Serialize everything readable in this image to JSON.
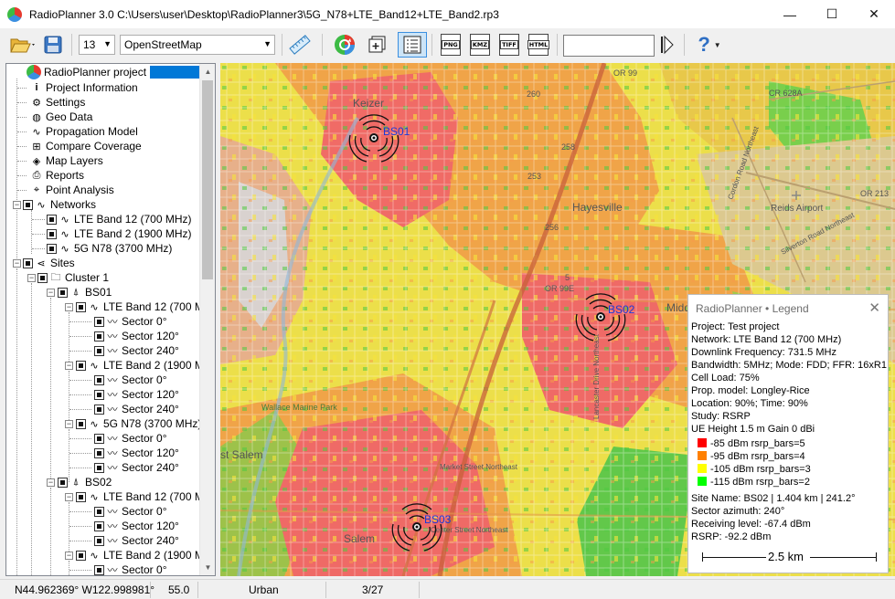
{
  "window": {
    "title": "RadioPlanner 3.0 C:\\Users\\user\\Desktop\\RadioPlanner3\\5G_N78+LTE_Band12+LTE_Band2.rp3",
    "minimize": "—",
    "maximize": "☐",
    "close": "✕"
  },
  "toolbar": {
    "zoom_value": "13",
    "map_source": "OpenStreetMap",
    "export_png": "PNG",
    "export_kmz": "KMZ",
    "export_tiff": "TIFF",
    "export_html": "HTML",
    "search_value": "",
    "help_label": "?"
  },
  "tree": {
    "root": "RadioPlanner project",
    "items": [
      "Project Information",
      "Settings",
      "Geo Data",
      "Propagation Model",
      "Compare Coverage",
      "Map Layers",
      "Reports",
      "Point Analysis"
    ],
    "networks_label": "Networks",
    "networks": [
      "LTE Band 12 (700 MHz)",
      "LTE Band 2 (1900 MHz)",
      "5G N78 (3700 MHz)"
    ],
    "sites_label": "Sites",
    "cluster": "Cluster 1",
    "bs01": "BS01",
    "bs02": "BS02",
    "band12_short": "LTE Band 12 (700 M",
    "band2_short": "LTE Band 2 (1900 M",
    "n78_short": "5G N78 (3700 MHz)",
    "sector0": "Sector 0°",
    "sector120": "Sector 120°",
    "sector240": "Sector 240°"
  },
  "map": {
    "labels": {
      "keizer": "Keizer",
      "hayesville": "Hayesville",
      "salem": "Salem",
      "east_salem": "st Salem",
      "reids_airport": "Reids Airport",
      "wallace_park": "Wallace Marine Park",
      "cr628a": "CR 628A",
      "or99e": "OR 99E",
      "market_st": "Market Street Northeast",
      "center_st": "Center Street Northeast",
      "silverton": "Silverton Road Northeast",
      "cordon": "Cordon Road Northeast",
      "lancaster": "Lancaster Drive Northeast",
      "midd": "Midd",
      "r253": "253",
      "r256": "256",
      "r258": "258",
      "r260": "260",
      "r5": "5",
      "or99": "OR 99",
      "or213": "OR 213"
    },
    "sites": [
      "BS01",
      "BS02",
      "BS03"
    ]
  },
  "legend": {
    "title": "RadioPlanner • Legend",
    "close": "✕",
    "lines": [
      "Project: Test project",
      "Network: LTE Band 12 (700 MHz)",
      "Downlink Frequency: 731.5 MHz",
      "Bandwidth: 5MHz; Mode: FDD; FFR: 16xR1",
      "Cell Load: 75%",
      "Prop. model: Longley-Rice",
      "Location: 90%; Time: 90%",
      "Study: RSRP",
      "UE  Height 1.5 m  Gain 0 dBi"
    ],
    "bins": [
      {
        "label": "-85 dBm rsrp_bars=5",
        "color": "#ff0000"
      },
      {
        "label": "-95 dBm rsrp_bars=4",
        "color": "#ff8000"
      },
      {
        "label": "-105 dBm rsrp_bars=3",
        "color": "#ffff00"
      },
      {
        "label": "-115 dBm rsrp_bars=2",
        "color": "#00ff00"
      }
    ],
    "site_lines": [
      "Site Name: BS02 | 1.404 km | 241.2°",
      "Sector azimuth: 240°",
      "Receiving level: -67.4 dBm",
      "RSRP: -92.2 dBm"
    ],
    "scale": "2.5 km"
  },
  "status": {
    "coords": "N44.962369°  W122.998981°",
    "elevation": "55.0",
    "clutter": "Urban",
    "page": "3/27"
  }
}
